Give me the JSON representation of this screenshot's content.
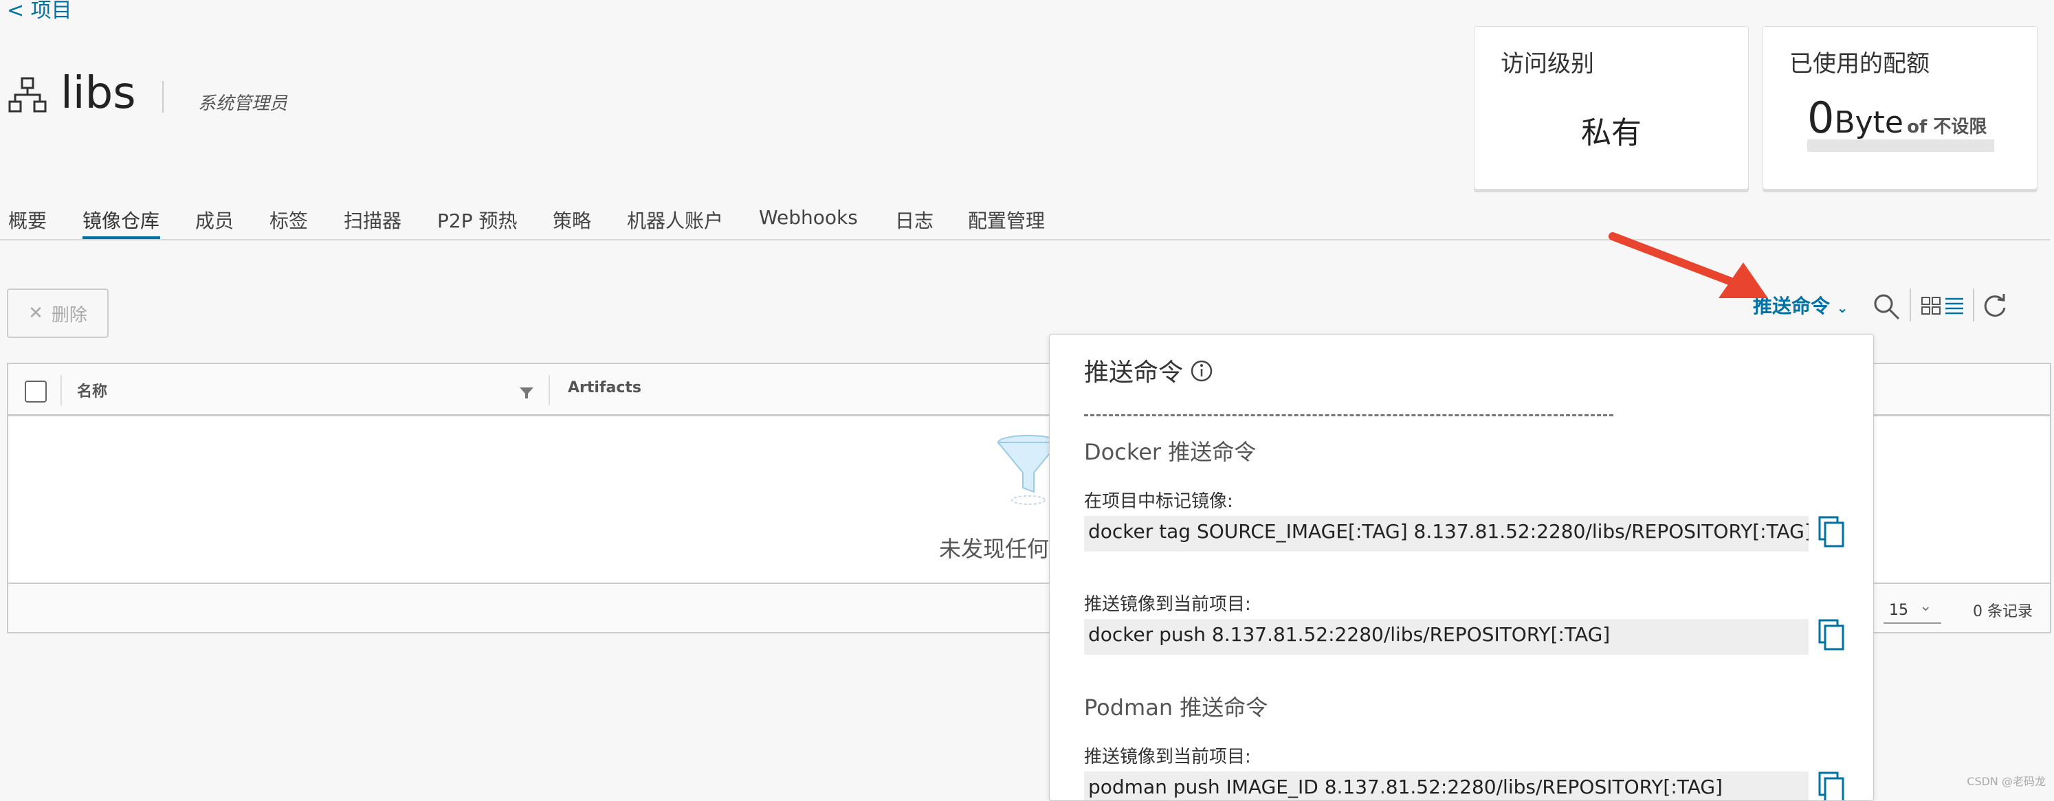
{
  "nav": {
    "back_label": "< 项目"
  },
  "project": {
    "name": "libs",
    "role": "系统管理员"
  },
  "cards": {
    "access": {
      "title": "访问级别",
      "value": "私有"
    },
    "quota": {
      "title": "已使用的配额",
      "used_num": "0",
      "used_unit": "Byte",
      "of_text": "of 不设限",
      "used_fraction": 0
    }
  },
  "tabs": [
    {
      "label": "概要"
    },
    {
      "label": "镜像仓库"
    },
    {
      "label": "成员"
    },
    {
      "label": "标签"
    },
    {
      "label": "扫描器"
    },
    {
      "label": "P2P 预热"
    },
    {
      "label": "策略"
    },
    {
      "label": "机器人账户"
    },
    {
      "label": "Webhooks"
    },
    {
      "label": "日志"
    },
    {
      "label": "配置管理"
    }
  ],
  "active_tab": "镜像仓库",
  "toolbar": {
    "delete_label": "删除",
    "push_label": "推送命令"
  },
  "table": {
    "col_name": "名称",
    "col_artifacts": "Artifacts",
    "empty_text": "未发现任何",
    "page_size": "15",
    "records": "0 条记录"
  },
  "popover": {
    "title": "推送命令",
    "docker_title": "Docker 推送命令",
    "docker_tag_label": "在项目中标记镜像:",
    "docker_tag_cmd": "docker tag SOURCE_IMAGE[:TAG] 8.137.81.52:2280/libs/REPOSITORY[:TAG]",
    "docker_push_label": "推送镜像到当前项目:",
    "docker_push_cmd": "docker push 8.137.81.52:2280/libs/REPOSITORY[:TAG]",
    "podman_title": "Podman 推送命令",
    "podman_push_label": "推送镜像到当前项目:",
    "podman_push_cmd": "podman push IMAGE_ID 8.137.81.52:2280/libs/REPOSITORY[:TAG]"
  },
  "watermark": "CSDN @老码龙",
  "colors": {
    "accent": "#0072a3",
    "arrow": "#e8442e"
  }
}
